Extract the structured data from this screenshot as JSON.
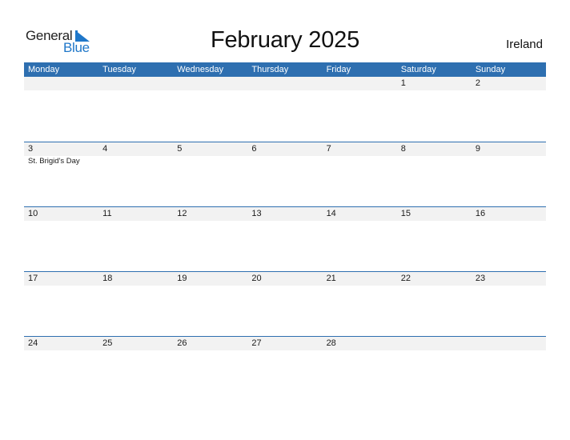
{
  "logo": {
    "line1": "General",
    "line2": "Blue"
  },
  "title": "February 2025",
  "country": "Ireland",
  "colors": {
    "accent": "#2e6fb0",
    "date_strip": "#f2f2f2",
    "logo_blue": "#1f77c9"
  },
  "weekdays": [
    "Monday",
    "Tuesday",
    "Wednesday",
    "Thursday",
    "Friday",
    "Saturday",
    "Sunday"
  ],
  "weeks": [
    {
      "dates": [
        "",
        "",
        "",
        "",
        "",
        "1",
        "2"
      ],
      "events": [
        "",
        "",
        "",
        "",
        "",
        "",
        ""
      ]
    },
    {
      "dates": [
        "3",
        "4",
        "5",
        "6",
        "7",
        "8",
        "9"
      ],
      "events": [
        "St. Brigid's Day",
        "",
        "",
        "",
        "",
        "",
        ""
      ]
    },
    {
      "dates": [
        "10",
        "11",
        "12",
        "13",
        "14",
        "15",
        "16"
      ],
      "events": [
        "",
        "",
        "",
        "",
        "",
        "",
        ""
      ]
    },
    {
      "dates": [
        "17",
        "18",
        "19",
        "20",
        "21",
        "22",
        "23"
      ],
      "events": [
        "",
        "",
        "",
        "",
        "",
        "",
        ""
      ]
    },
    {
      "dates": [
        "24",
        "25",
        "26",
        "27",
        "28",
        "",
        ""
      ],
      "events": [
        "",
        "",
        "",
        "",
        "",
        "",
        ""
      ]
    }
  ]
}
